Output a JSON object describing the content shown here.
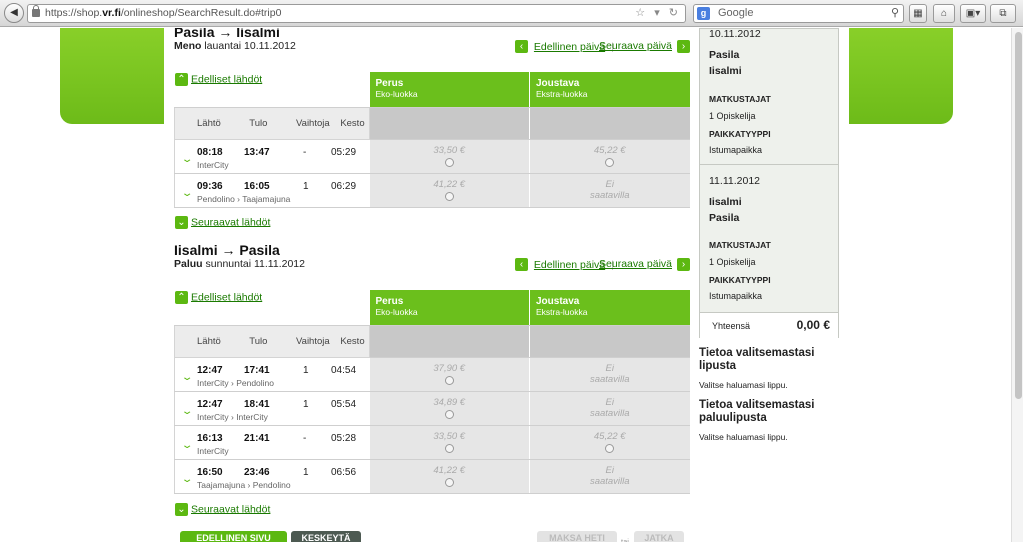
{
  "browser": {
    "url_host_prefix": "https://shop.",
    "url_host_bold": "vr.fi",
    "url_path": "/onlineshop/SearchResult.do#trip0",
    "search_placeholder": "Google"
  },
  "outbound": {
    "title": "Pasila → Iisalmi",
    "direction_label": "Meno",
    "date_text": "lauantai 10.11.2012",
    "prev_day": "Edellinen päivä",
    "next_day": "Seuraava päivä",
    "earlier": "Edelliset lähdöt",
    "later": "Seuraavat lähdöt",
    "rows": [
      {
        "dep": "08:18",
        "arr": "13:47",
        "changes": "-",
        "duration": "05:29",
        "trains": "InterCity",
        "perus": "33,50 €",
        "joustava": "45,22 €"
      },
      {
        "dep": "09:36",
        "arr": "16:05",
        "changes": "1",
        "duration": "06:29",
        "trains": "Pendolino › Taajamajuna",
        "perus": "41,22 €",
        "joustava": "Ei saatavilla"
      }
    ]
  },
  "return": {
    "title": "Iisalmi → Pasila",
    "direction_label": "Paluu",
    "date_text": "sunnuntai 11.11.2012",
    "prev_day": "Edellinen päivä",
    "next_day": "Seuraava päivä",
    "earlier": "Edelliset lähdöt",
    "later": "Seuraavat lähdöt",
    "rows": [
      {
        "dep": "12:47",
        "arr": "17:41",
        "changes": "1",
        "duration": "04:54",
        "trains": "InterCity › Pendolino",
        "perus": "37,90 €",
        "joustava": "Ei saatavilla"
      },
      {
        "dep": "12:47",
        "arr": "18:41",
        "changes": "1",
        "duration": "05:54",
        "trains": "InterCity › InterCity",
        "perus": "34,89 €",
        "joustava": "Ei saatavilla"
      },
      {
        "dep": "16:13",
        "arr": "21:41",
        "changes": "-",
        "duration": "05:28",
        "trains": "InterCity",
        "perus": "33,50 €",
        "joustava": "45,22 €"
      },
      {
        "dep": "16:50",
        "arr": "23:46",
        "changes": "1",
        "duration": "06:56",
        "trains": "Taajamajuna › Pendolino",
        "perus": "41,22 €",
        "joustava": "Ei saatavilla"
      }
    ]
  },
  "table_headers": {
    "dep": "Lähtö",
    "arr": "Tulo",
    "changes": "Vaihtoja",
    "duration": "Kesto",
    "fare1_name": "Perus",
    "fare1_class": "Eko-luokka",
    "fare2_name": "Joustava",
    "fare2_class": "Ekstra-luokka"
  },
  "summary": {
    "out_date": "10.11.2012",
    "out_from": "Pasila",
    "out_to": "Iisalmi",
    "travellers_label": "MATKUSTAJAT",
    "travellers_value": "1 Opiskelija",
    "seat_label": "PAIKKATYYPPI",
    "seat_value": "Istumapaikka",
    "ret_date": "11.11.2012",
    "ret_from": "Iisalmi",
    "ret_to": "Pasila",
    "total_label": "Yhteensä",
    "total_value": "0,00 €"
  },
  "info": {
    "out_title": "Tietoa valitsemastasi lipusta",
    "out_text": "Valitse haluamasi lippu.",
    "ret_title": "Tietoa valitsemastasi paluulipusta",
    "ret_text": "Valitse haluamasi lippu."
  },
  "buttons": {
    "prev_page": "EDELLINEN SIVU",
    "cancel": "KESKEYTÄ",
    "pay_now": "MAKSA HETI",
    "or": "tai",
    "continue": "JATKA"
  }
}
